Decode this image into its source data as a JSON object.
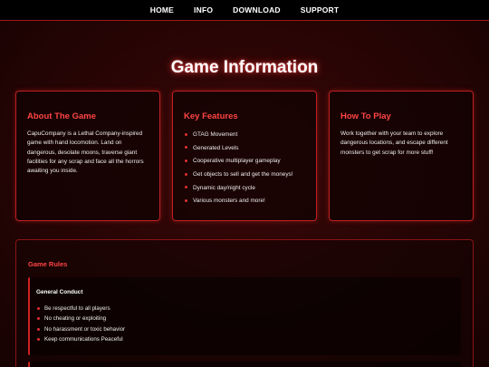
{
  "nav": {
    "items": [
      {
        "label": "HOME"
      },
      {
        "label": "INFO"
      },
      {
        "label": "DOWNLOAD"
      },
      {
        "label": "SUPPORT"
      }
    ]
  },
  "page": {
    "title": "Game Information"
  },
  "cards": {
    "about": {
      "title": "About The Game",
      "text": "CapuCompany is a Lethal Company-inspired game with hand locomotion. Land on dangerous, desolate moons, traverse giant facilities for any scrap and face all the horrors awaiting you inside."
    },
    "features": {
      "title": "Key Features",
      "items": [
        "GTAG Movement",
        "Generated Levels",
        "Cooperative multiplayer gameplay",
        "Get objects to sell and get the moneys!",
        "Dynamic day/night cycle",
        "Various monsters and more!"
      ]
    },
    "howto": {
      "title": "How To Play",
      "text": "Work together with your team to explore dangerous locations, and escape different monsters to get scrap for more stuff!"
    }
  },
  "rules": {
    "title": "Game Rules",
    "general": {
      "title": "General Conduct",
      "items": [
        "Be respectful to all players",
        "No cheating or exploiting",
        "No harassment or toxic behavior",
        "Keep communications Peaceful"
      ]
    }
  },
  "colors": {
    "accent": "#ff4444",
    "border": "#c02020",
    "background": "#2a0505",
    "navbar": "#000000"
  }
}
